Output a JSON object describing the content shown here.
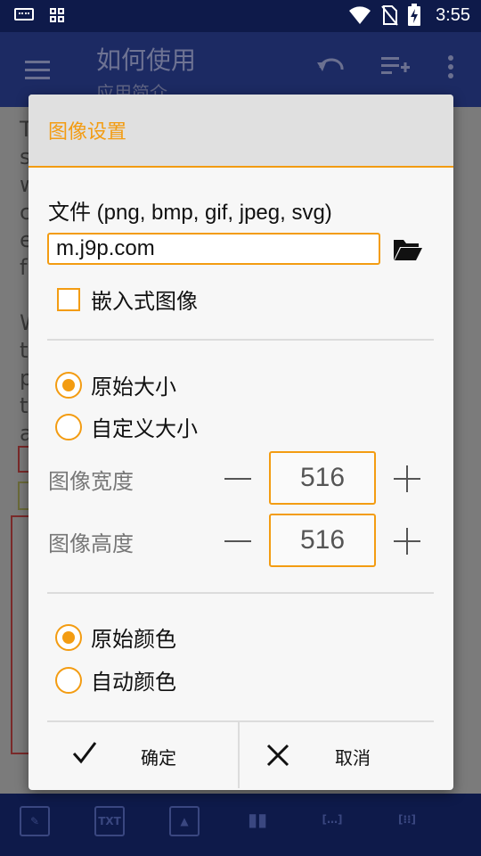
{
  "status_bar": {
    "time": "3:55"
  },
  "app_bar": {
    "title": "如何使用",
    "subtitle": "应用简介"
  },
  "background_text_lines": [
    "T",
    "s",
    "w",
    "c",
    "e",
    "f",
    "",
    "W",
    "t",
    "p",
    "t",
    "a"
  ],
  "bottom_bar": {
    "txt_label": "TXT"
  },
  "dialog": {
    "title": "图像设置",
    "file_label": "文件 (png, bmp, gif, jpeg, svg)",
    "file_value": "m.j9p.com",
    "embedded_label": "嵌入式图像",
    "size_options": [
      "原始大小",
      "自定义大小"
    ],
    "selected_size": "原始大小",
    "width_label": "图像宽度",
    "width_value": "516",
    "height_label": "图像高度",
    "height_value": "516",
    "color_options": [
      "原始颜色",
      "自动颜色"
    ],
    "selected_color": "原始颜色",
    "ok_label": "确定",
    "cancel_label": "取消"
  },
  "colors": {
    "accent": "#f39c12",
    "primary_dark": "#0e1a4a"
  }
}
